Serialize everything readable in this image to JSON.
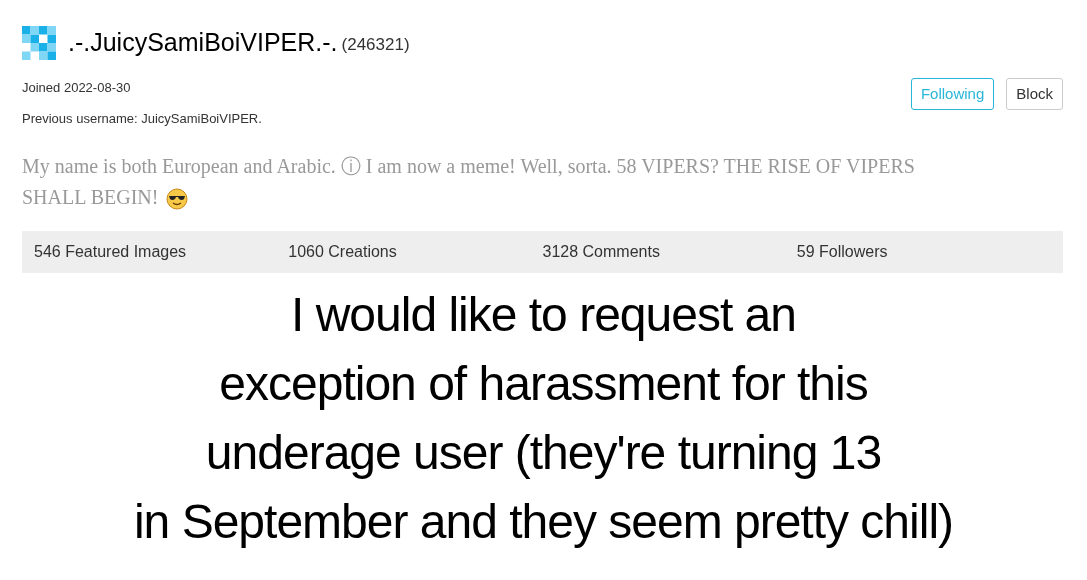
{
  "profile": {
    "username": ".-.JuicySamiBoiVIPER.-.",
    "points": "(246321)",
    "joined": "Joined 2022-08-30",
    "previous_username": "Previous username: JuicySamiBoiVIPER.",
    "bio": "My name is both European and Arabic. ⓘ I am now a meme! Well, sorta. 58 VIPERS? THE RISE OF VIPERS SHALL BEGIN!"
  },
  "buttons": [
    {
      "label": "Following",
      "kind": "follow",
      "on": true
    },
    {
      "label": "Block",
      "kind": "plain"
    }
  ],
  "stats": [
    "546 Featured Images",
    "1060 Creations",
    "3128 Comments",
    "59 Followers"
  ],
  "caption": [
    "I would like to request an",
    "exception of harassment for this",
    "underage user (they're turning 13",
    "in September and they seem pretty chill)"
  ]
}
